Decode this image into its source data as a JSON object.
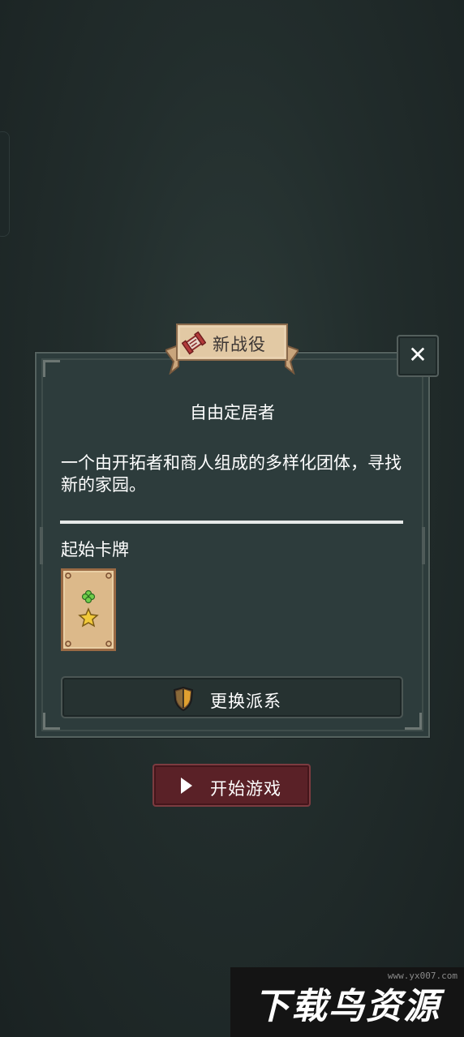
{
  "banner": {
    "title": "新战役",
    "icon": "scroll-icon"
  },
  "close_button": {
    "label": "✕",
    "icon": "close-icon"
  },
  "faction": {
    "name": "自由定居者",
    "description": "一个由开拓者和商人组成的多样化团体，寻找新的家园。"
  },
  "starting_cards": {
    "label": "起始卡牌",
    "cards": [
      {
        "icon": "clover-star-icon"
      }
    ]
  },
  "switch_faction_button": {
    "label": "更换派系",
    "icon": "shield-icon"
  },
  "start_game_button": {
    "label": "开始游戏",
    "icon": "play-icon"
  },
  "watermark": {
    "text": "下载鸟资源",
    "url": "www.yx007.com"
  },
  "colors": {
    "background": "#222d2c",
    "panel": "#2d3c3c",
    "parchment": "#e2c9a4",
    "start_button": "#5a2127",
    "card": "#dcb98a"
  }
}
